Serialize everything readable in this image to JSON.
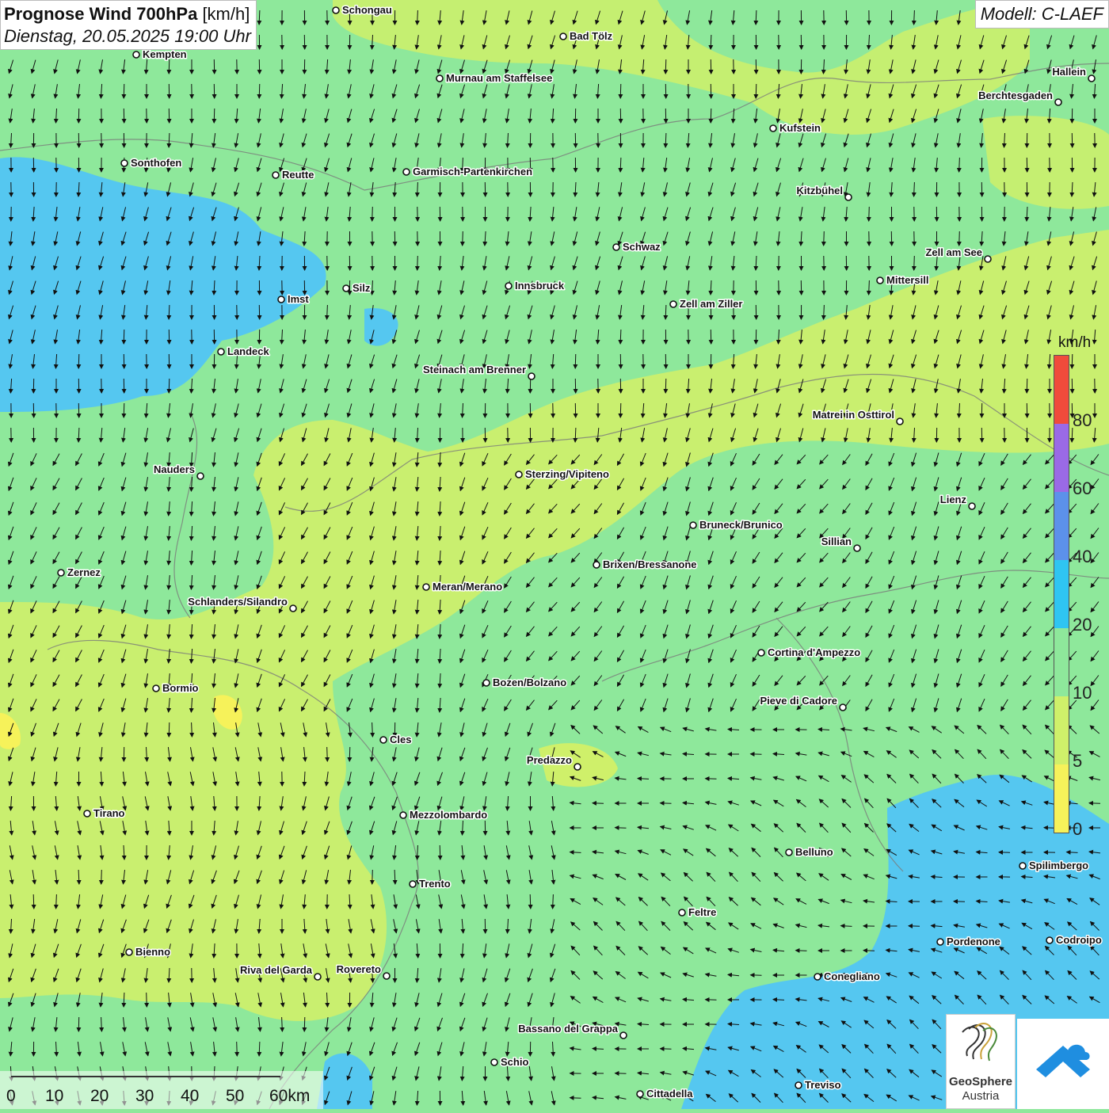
{
  "header": {
    "title_bold": "Prognose Wind 700hPa",
    "title_unit": "[km/h]",
    "date": "Dienstag, 20.05.2025 19:00 Uhr",
    "model": "Modell: C-LAEF"
  },
  "legend": {
    "unit": "km/h",
    "ticks": [
      "80",
      "60",
      "40",
      "20",
      "10",
      "5",
      "0"
    ],
    "colors": [
      "#f04b3b",
      "#9a6ae6",
      "#5c91ea",
      "#2fc5f2",
      "#8ee89b",
      "#cff06a",
      "#f6f25a"
    ]
  },
  "scale_bar": {
    "labels": [
      "0",
      "10",
      "20",
      "30",
      "40",
      "50",
      "60km"
    ]
  },
  "logos": {
    "geosphere_line1": "GeoSphere",
    "geosphere_line2": "Austria"
  },
  "places": [
    {
      "name": "Schongau"
    },
    {
      "name": "Bad Tölz"
    },
    {
      "name": "Kempten"
    },
    {
      "name": "Murnau am Staffelsee"
    },
    {
      "name": "Hallein"
    },
    {
      "name": "Berchtesgaden"
    },
    {
      "name": "Kufstein"
    },
    {
      "name": "Sonthofen"
    },
    {
      "name": "Reutte"
    },
    {
      "name": "Garmisch-Partenkirchen"
    },
    {
      "name": "Kitzbühel"
    },
    {
      "name": "Schwaz"
    },
    {
      "name": "Zell am See"
    },
    {
      "name": "Mittersill"
    },
    {
      "name": "Silz"
    },
    {
      "name": "Innsbruck"
    },
    {
      "name": "Imst"
    },
    {
      "name": "Zell am Ziller"
    },
    {
      "name": "Landeck"
    },
    {
      "name": "Steinach am Brenner"
    },
    {
      "name": "Matrei in Osttirol"
    },
    {
      "name": "Nauders"
    },
    {
      "name": "Sterzing/Vipiteno"
    },
    {
      "name": "Lienz"
    },
    {
      "name": "Bruneck/Brunico"
    },
    {
      "name": "Sillian"
    },
    {
      "name": "Zernez"
    },
    {
      "name": "Brixen/Bressanone"
    },
    {
      "name": "Meran/Merano"
    },
    {
      "name": "Schlanders/Silandro"
    },
    {
      "name": "Cortina d'Ampezzo"
    },
    {
      "name": "Bozen/Bolzano"
    },
    {
      "name": "Bormio"
    },
    {
      "name": "Pieve di Cadore"
    },
    {
      "name": "Cles"
    },
    {
      "name": "Predazzo"
    },
    {
      "name": "Tirano"
    },
    {
      "name": "Mezzolombardo"
    },
    {
      "name": "Belluno"
    },
    {
      "name": "Spilimbergo"
    },
    {
      "name": "Trento"
    },
    {
      "name": "Feltre"
    },
    {
      "name": "Pordenone"
    },
    {
      "name": "Codroipo"
    },
    {
      "name": "Bienno"
    },
    {
      "name": "Riva del Garda"
    },
    {
      "name": "Rovereto"
    },
    {
      "name": "Conegliano"
    },
    {
      "name": "Bassano del Grappa"
    },
    {
      "name": "Schio"
    },
    {
      "name": "Treviso"
    },
    {
      "name": "Cittadella"
    }
  ]
}
